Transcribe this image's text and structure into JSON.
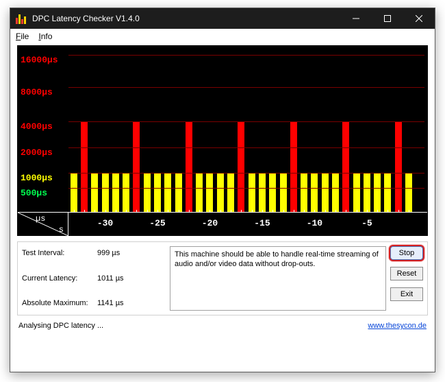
{
  "titlebar": {
    "title": "DPC Latency Checker V1.4.0"
  },
  "menu": {
    "file": "File",
    "info": "Info"
  },
  "chart_data": {
    "type": "bar",
    "x_unit_top": "µs",
    "x_unit_bottom": "s",
    "y_ticks": [
      {
        "label": "16000µs",
        "color": "#ff0000",
        "pos_pct": 3
      },
      {
        "label": "8000µs",
        "color": "#ff0000",
        "pos_pct": 23
      },
      {
        "label": "4000µs",
        "color": "#ff0000",
        "pos_pct": 44
      },
      {
        "label": "2000µs",
        "color": "#ff0000",
        "pos_pct": 60
      },
      {
        "label": "1000µs",
        "color": "#ffff00",
        "pos_pct": 76
      },
      {
        "label": "500µs",
        "color": "#00ff50",
        "pos_pct": 85
      }
    ],
    "gridlines_pct": [
      3,
      23,
      44,
      60,
      76,
      85,
      100
    ],
    "x_ticks": [
      {
        "label": "-30",
        "pos_pct": 10
      },
      {
        "label": "-25",
        "pos_pct": 25
      },
      {
        "label": "-20",
        "pos_pct": 40
      },
      {
        "label": "-15",
        "pos_pct": 55
      },
      {
        "label": "-10",
        "pos_pct": 70
      },
      {
        "label": "-5",
        "pos_pct": 85
      }
    ],
    "bars": [
      {
        "x_s": -33,
        "value_us": 1000,
        "color": "yellow"
      },
      {
        "x_s": -32,
        "value_us": 4000,
        "color": "red"
      },
      {
        "x_s": -31,
        "value_us": 1000,
        "color": "yellow"
      },
      {
        "x_s": -30,
        "value_us": 1000,
        "color": "yellow"
      },
      {
        "x_s": -29,
        "value_us": 1000,
        "color": "yellow"
      },
      {
        "x_s": -28,
        "value_us": 1000,
        "color": "yellow"
      },
      {
        "x_s": -27,
        "value_us": 4000,
        "color": "red"
      },
      {
        "x_s": -26,
        "value_us": 1000,
        "color": "yellow"
      },
      {
        "x_s": -25,
        "value_us": 1000,
        "color": "yellow"
      },
      {
        "x_s": -24,
        "value_us": 1000,
        "color": "yellow"
      },
      {
        "x_s": -23,
        "value_us": 1000,
        "color": "yellow"
      },
      {
        "x_s": -22,
        "value_us": 4000,
        "color": "red"
      },
      {
        "x_s": -21,
        "value_us": 1000,
        "color": "yellow"
      },
      {
        "x_s": -20,
        "value_us": 1000,
        "color": "yellow"
      },
      {
        "x_s": -19,
        "value_us": 1000,
        "color": "yellow"
      },
      {
        "x_s": -18,
        "value_us": 1000,
        "color": "yellow"
      },
      {
        "x_s": -17,
        "value_us": 4000,
        "color": "red"
      },
      {
        "x_s": -16,
        "value_us": 1000,
        "color": "yellow"
      },
      {
        "x_s": -15,
        "value_us": 1000,
        "color": "yellow"
      },
      {
        "x_s": -14,
        "value_us": 1000,
        "color": "yellow"
      },
      {
        "x_s": -13,
        "value_us": 1000,
        "color": "yellow"
      },
      {
        "x_s": -12,
        "value_us": 4000,
        "color": "red"
      },
      {
        "x_s": -11,
        "value_us": 1000,
        "color": "yellow"
      },
      {
        "x_s": -10,
        "value_us": 1000,
        "color": "yellow"
      },
      {
        "x_s": -9,
        "value_us": 1000,
        "color": "yellow"
      },
      {
        "x_s": -8,
        "value_us": 1000,
        "color": "yellow"
      },
      {
        "x_s": -7,
        "value_us": 4000,
        "color": "red"
      },
      {
        "x_s": -6,
        "value_us": 1000,
        "color": "yellow"
      },
      {
        "x_s": -5,
        "value_us": 1000,
        "color": "yellow"
      },
      {
        "x_s": -4,
        "value_us": 1000,
        "color": "yellow"
      },
      {
        "x_s": -3,
        "value_us": 1000,
        "color": "yellow"
      },
      {
        "x_s": -2,
        "value_us": 4000,
        "color": "red"
      },
      {
        "x_s": -1,
        "value_us": 1000,
        "color": "yellow"
      }
    ]
  },
  "stats": {
    "test_interval_label": "Test Interval:",
    "test_interval_value": "999 µs",
    "current_latency_label": "Current Latency:",
    "current_latency_value": "1011 µs",
    "absolute_max_label": "Absolute Maximum:",
    "absolute_max_value": "1141 µs"
  },
  "description": "This machine should be able to handle real-time streaming of audio and/or video data without drop-outs.",
  "buttons": {
    "stop": "Stop",
    "reset": "Reset",
    "exit": "Exit"
  },
  "status": {
    "text": "Analysing DPC latency ...",
    "link": "www.thesycon.de"
  }
}
